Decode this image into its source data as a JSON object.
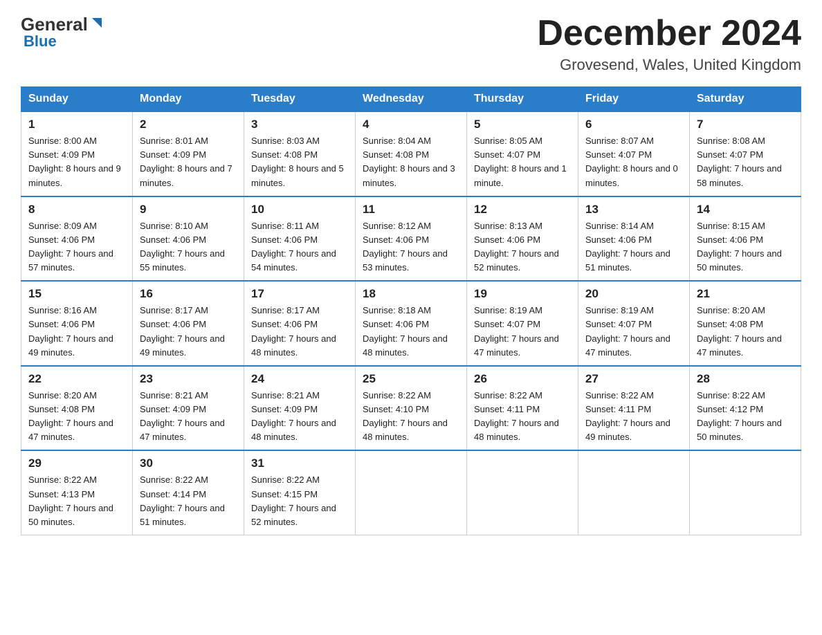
{
  "header": {
    "logo_general": "General",
    "logo_blue": "Blue",
    "calendar_title": "December 2024",
    "location": "Grovesend, Wales, United Kingdom"
  },
  "days_of_week": [
    "Sunday",
    "Monday",
    "Tuesday",
    "Wednesday",
    "Thursday",
    "Friday",
    "Saturday"
  ],
  "weeks": [
    [
      {
        "day": "1",
        "sunrise": "8:00 AM",
        "sunset": "4:09 PM",
        "daylight": "8 hours and 9 minutes."
      },
      {
        "day": "2",
        "sunrise": "8:01 AM",
        "sunset": "4:09 PM",
        "daylight": "8 hours and 7 minutes."
      },
      {
        "day": "3",
        "sunrise": "8:03 AM",
        "sunset": "4:08 PM",
        "daylight": "8 hours and 5 minutes."
      },
      {
        "day": "4",
        "sunrise": "8:04 AM",
        "sunset": "4:08 PM",
        "daylight": "8 hours and 3 minutes."
      },
      {
        "day": "5",
        "sunrise": "8:05 AM",
        "sunset": "4:07 PM",
        "daylight": "8 hours and 1 minute."
      },
      {
        "day": "6",
        "sunrise": "8:07 AM",
        "sunset": "4:07 PM",
        "daylight": "8 hours and 0 minutes."
      },
      {
        "day": "7",
        "sunrise": "8:08 AM",
        "sunset": "4:07 PM",
        "daylight": "7 hours and 58 minutes."
      }
    ],
    [
      {
        "day": "8",
        "sunrise": "8:09 AM",
        "sunset": "4:06 PM",
        "daylight": "7 hours and 57 minutes."
      },
      {
        "day": "9",
        "sunrise": "8:10 AM",
        "sunset": "4:06 PM",
        "daylight": "7 hours and 55 minutes."
      },
      {
        "day": "10",
        "sunrise": "8:11 AM",
        "sunset": "4:06 PM",
        "daylight": "7 hours and 54 minutes."
      },
      {
        "day": "11",
        "sunrise": "8:12 AM",
        "sunset": "4:06 PM",
        "daylight": "7 hours and 53 minutes."
      },
      {
        "day": "12",
        "sunrise": "8:13 AM",
        "sunset": "4:06 PM",
        "daylight": "7 hours and 52 minutes."
      },
      {
        "day": "13",
        "sunrise": "8:14 AM",
        "sunset": "4:06 PM",
        "daylight": "7 hours and 51 minutes."
      },
      {
        "day": "14",
        "sunrise": "8:15 AM",
        "sunset": "4:06 PM",
        "daylight": "7 hours and 50 minutes."
      }
    ],
    [
      {
        "day": "15",
        "sunrise": "8:16 AM",
        "sunset": "4:06 PM",
        "daylight": "7 hours and 49 minutes."
      },
      {
        "day": "16",
        "sunrise": "8:17 AM",
        "sunset": "4:06 PM",
        "daylight": "7 hours and 49 minutes."
      },
      {
        "day": "17",
        "sunrise": "8:17 AM",
        "sunset": "4:06 PM",
        "daylight": "7 hours and 48 minutes."
      },
      {
        "day": "18",
        "sunrise": "8:18 AM",
        "sunset": "4:06 PM",
        "daylight": "7 hours and 48 minutes."
      },
      {
        "day": "19",
        "sunrise": "8:19 AM",
        "sunset": "4:07 PM",
        "daylight": "7 hours and 47 minutes."
      },
      {
        "day": "20",
        "sunrise": "8:19 AM",
        "sunset": "4:07 PM",
        "daylight": "7 hours and 47 minutes."
      },
      {
        "day": "21",
        "sunrise": "8:20 AM",
        "sunset": "4:08 PM",
        "daylight": "7 hours and 47 minutes."
      }
    ],
    [
      {
        "day": "22",
        "sunrise": "8:20 AM",
        "sunset": "4:08 PM",
        "daylight": "7 hours and 47 minutes."
      },
      {
        "day": "23",
        "sunrise": "8:21 AM",
        "sunset": "4:09 PM",
        "daylight": "7 hours and 47 minutes."
      },
      {
        "day": "24",
        "sunrise": "8:21 AM",
        "sunset": "4:09 PM",
        "daylight": "7 hours and 48 minutes."
      },
      {
        "day": "25",
        "sunrise": "8:22 AM",
        "sunset": "4:10 PM",
        "daylight": "7 hours and 48 minutes."
      },
      {
        "day": "26",
        "sunrise": "8:22 AM",
        "sunset": "4:11 PM",
        "daylight": "7 hours and 48 minutes."
      },
      {
        "day": "27",
        "sunrise": "8:22 AM",
        "sunset": "4:11 PM",
        "daylight": "7 hours and 49 minutes."
      },
      {
        "day": "28",
        "sunrise": "8:22 AM",
        "sunset": "4:12 PM",
        "daylight": "7 hours and 50 minutes."
      }
    ],
    [
      {
        "day": "29",
        "sunrise": "8:22 AM",
        "sunset": "4:13 PM",
        "daylight": "7 hours and 50 minutes."
      },
      {
        "day": "30",
        "sunrise": "8:22 AM",
        "sunset": "4:14 PM",
        "daylight": "7 hours and 51 minutes."
      },
      {
        "day": "31",
        "sunrise": "8:22 AM",
        "sunset": "4:15 PM",
        "daylight": "7 hours and 52 minutes."
      },
      null,
      null,
      null,
      null
    ]
  ],
  "labels": {
    "sunrise_prefix": "Sunrise: ",
    "sunset_prefix": "Sunset: ",
    "daylight_prefix": "Daylight: "
  }
}
